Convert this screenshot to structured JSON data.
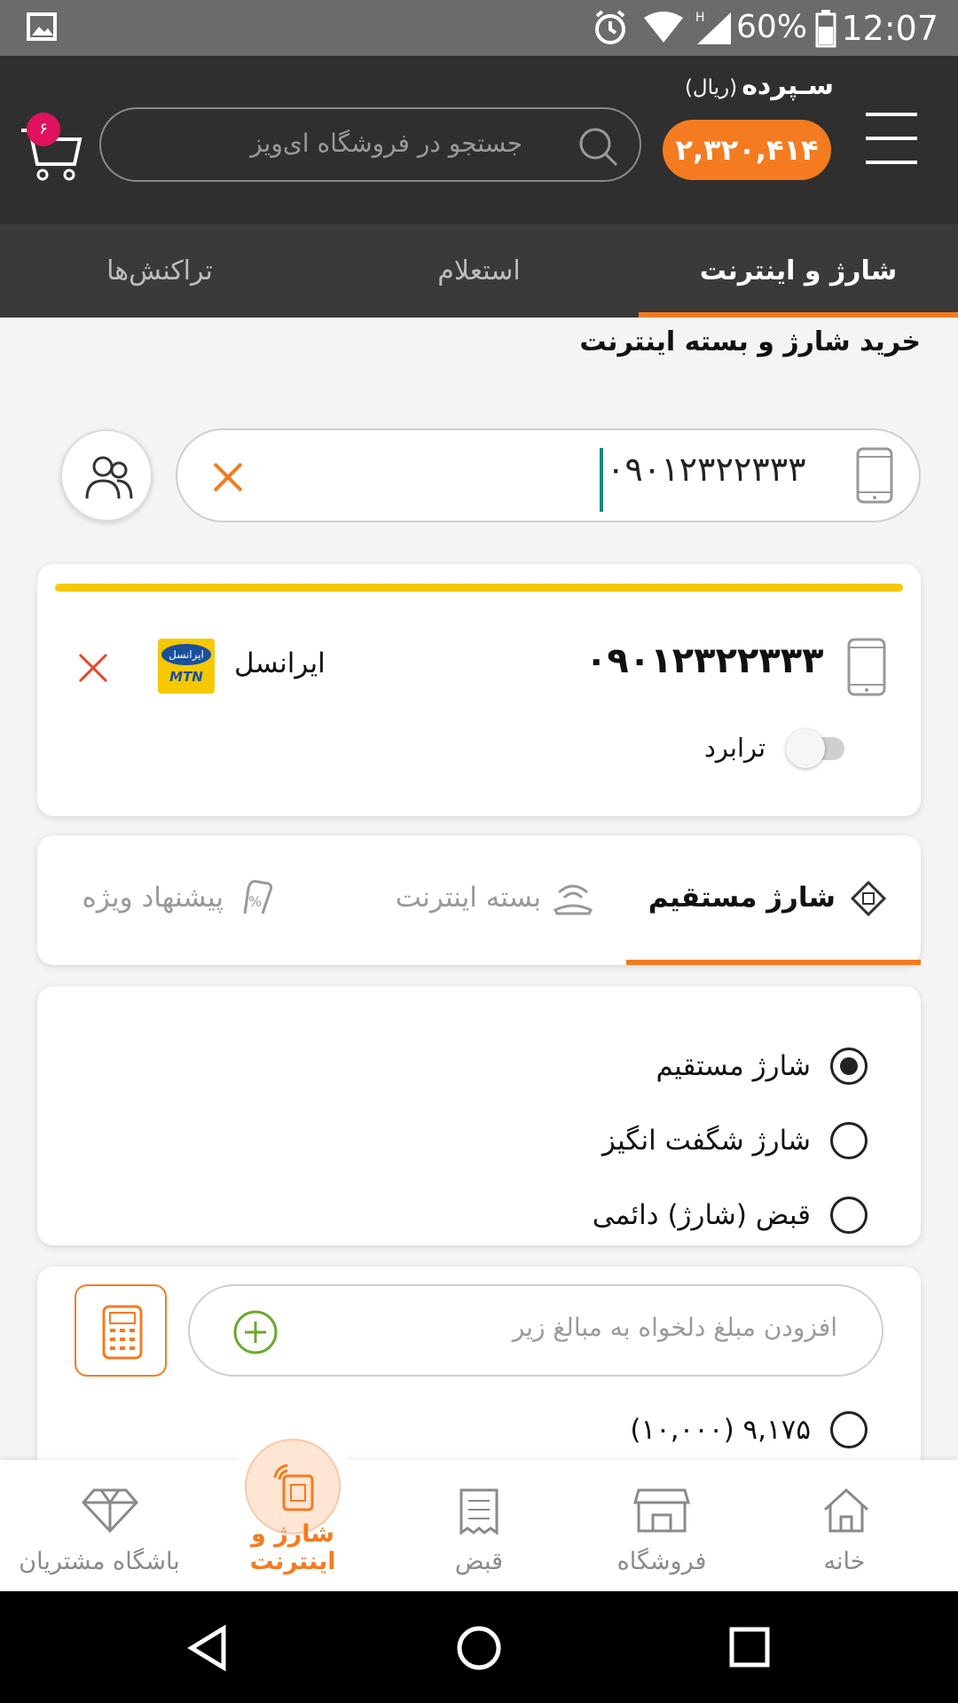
{
  "status_bar": {
    "time": "12:07",
    "battery": "60%"
  },
  "header": {
    "balance_label": "سـپرده",
    "balance_unit": "(ریال)",
    "balance_value": "۲,۳۲۰,۴۱۴",
    "search_placeholder": "جستجو در فروشگاه ای‌ویز",
    "cart_count": "۶"
  },
  "tabs": [
    {
      "label": "شارژ و اینترنت",
      "active": true
    },
    {
      "label": "استعلام",
      "active": false
    },
    {
      "label": "تراکنش‌ها",
      "active": false
    }
  ],
  "page": {
    "title": "خرید شارژ و بسته اینترنت"
  },
  "phone_input": {
    "value": "۰۹۰۱۲۳۲۲۳۳۳"
  },
  "selected_number": {
    "number": "۰۹۰۱۲۳۲۲۳۳۳",
    "operator": "ایرانسل",
    "logo_top": "ایرانسل",
    "logo_bottom": "MTN",
    "transfer_label": "ترابرد"
  },
  "charge_tabs": [
    {
      "label": "شارژ مستقیم",
      "icon": "diamond-sim-icon",
      "active": true
    },
    {
      "label": "بسته اینترنت",
      "icon": "wifi-hand-icon",
      "active": false
    },
    {
      "label": "پیشنهاد ویژه",
      "icon": "percent-hand-icon",
      "active": false
    }
  ],
  "charge_types": [
    {
      "label": "شارژ مستقیم",
      "selected": true
    },
    {
      "label": "شارژ شگفت انگیز",
      "selected": false
    },
    {
      "label": "قبض (شارژ) دائمی",
      "selected": false
    }
  ],
  "amount": {
    "placeholder": "افزودن مبلغ دلخواه به مبالغ زیر",
    "first_option": "۹,۱۷۵ (۱۰,۰۰۰)"
  },
  "bottom_nav": [
    {
      "label": "خانه",
      "icon": "home-icon",
      "active": false
    },
    {
      "label": "فروشگاه",
      "icon": "store-icon",
      "active": false
    },
    {
      "label": "قبض",
      "icon": "receipt-icon",
      "active": false
    },
    {
      "label": "شارژ و اینترنت",
      "icon": "sim-signal-icon",
      "active": true
    },
    {
      "label": "باشگاه مشتریان",
      "icon": "diamond-icon",
      "active": false
    }
  ],
  "colors": {
    "accent": "#f47b20",
    "header": "#2f2f2f",
    "tabs": "#3a3a3a",
    "yellow": "#f5c800",
    "close": "#e8452c",
    "cursor": "#1a8a7a",
    "plus": "#6aaa2c"
  }
}
